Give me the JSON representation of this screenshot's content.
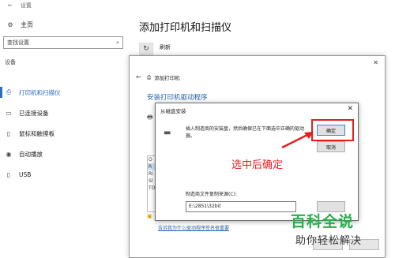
{
  "titlebar": {
    "back_icon": "left-arrow-icon",
    "title": "设置"
  },
  "sidebar": {
    "home_label": "主页",
    "search_placeholder": "查找设置",
    "section_title": "设备",
    "items": [
      {
        "label": "打印机和扫描仪",
        "icon": "printer-icon",
        "selected": true
      },
      {
        "label": "已连接设备",
        "icon": "devices-icon",
        "selected": false
      },
      {
        "label": "鼠标和触摸板",
        "icon": "mouse-icon",
        "selected": false
      },
      {
        "label": "自动播放",
        "icon": "autoplay-icon",
        "selected": false
      },
      {
        "label": "USB",
        "icon": "usb-icon",
        "selected": false
      }
    ]
  },
  "main": {
    "title": "添加打印机和扫描仪",
    "refresh_label": "刷新"
  },
  "wizard": {
    "title": "添加打印机",
    "heading": "安装打印机驱动程序",
    "list_items": [
      "O",
      "R",
      "Ri",
      "Sl",
      "TO"
    ],
    "link": "告诉我为什么驱动程序签名很重要"
  },
  "dialog": {
    "title": "从磁盘安装",
    "message": "插入制造商的安装盘，然后确保已在下面选中正确的驱动器。",
    "ok_label": "确定",
    "cancel_label": "取消",
    "path_label": "制造商文件复制来源(C):",
    "path_value": "E:\\2851\\32bit"
  },
  "annotation": {
    "text": "选中后确定",
    "color": "#e21f1f"
  },
  "watermark": {
    "main": "百科全说",
    "sub": "助你轻松解决"
  },
  "colors": {
    "accent": "#2b6cc4",
    "highlight": "#e21f1f",
    "watermark": "#25b04a"
  }
}
